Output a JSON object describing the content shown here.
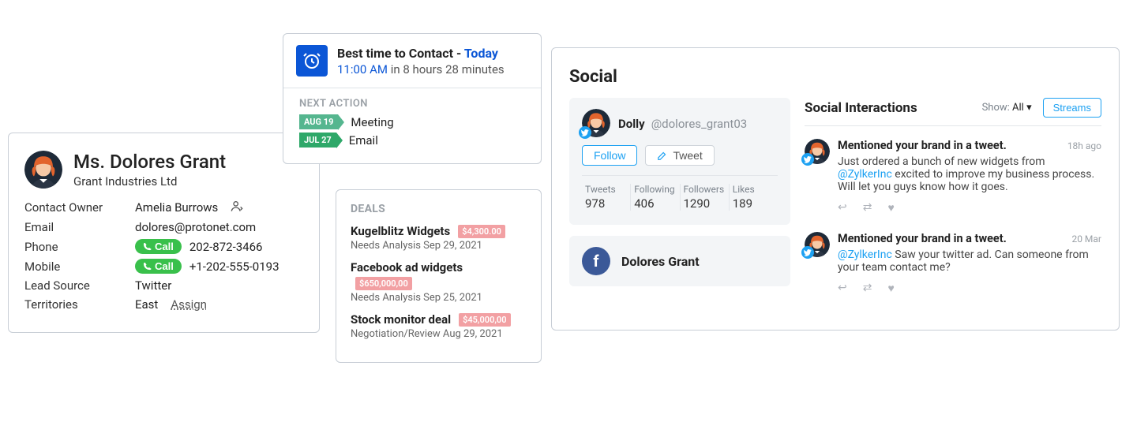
{
  "contact": {
    "name": "Ms. Dolores Grant",
    "company": "Grant Industries Ltd",
    "fields": {
      "owner_label": "Contact Owner",
      "owner_value": "Amelia Burrows",
      "email_label": "Email",
      "email_value": "dolores@protonet.com",
      "phone_label": "Phone",
      "phone_value": "202-872-3466",
      "mobile_label": "Mobile",
      "mobile_value": "+1-202-555-0193",
      "lead_label": "Lead Source",
      "lead_value": "Twitter",
      "territory_label": "Territories",
      "territory_value": "East",
      "assign_label": "Assign",
      "call_label": "Call"
    }
  },
  "best_time": {
    "title_prefix": "Best time to Contact - ",
    "day": "Today",
    "time": "11:00 AM",
    "countdown": " in 8 hours 28 minutes",
    "next_action_label": "NEXT ACTION",
    "actions": [
      {
        "date": "AUG 19",
        "label": "Meeting"
      },
      {
        "date": "JUL 27",
        "label": "Email"
      }
    ]
  },
  "deals": {
    "heading": "DEALS",
    "items": [
      {
        "name": "Kugelblitz Widgets",
        "amount": "$4,300.00",
        "sub": "Needs Analysis Sep 29, 2021"
      },
      {
        "name": "Facebook ad widgets",
        "amount": "$650,000,00",
        "sub": "Needs Analysis Sep 25, 2021"
      },
      {
        "name": "Stock monitor deal",
        "amount": "$45,000,00",
        "sub": "Negotiation/Review Aug 29, 2021"
      }
    ]
  },
  "social": {
    "title": "Social",
    "profile": {
      "display_name": "Dolly",
      "handle": "@dolores_grant03",
      "follow_label": "Follow",
      "tweet_label": "Tweet",
      "stats": {
        "tweets_label": "Tweets",
        "tweets": "978",
        "following_label": "Following",
        "following": "406",
        "followers_label": "Followers",
        "followers": "1290",
        "likes_label": "Likes",
        "likes": "189"
      }
    },
    "facebook_name": "Dolores Grant",
    "interactions": {
      "heading": "Social Interactions",
      "show_label": "Show:",
      "show_value": "All",
      "streams_label": "Streams",
      "items": [
        {
          "title": "Mentioned your brand in a tweet.",
          "time": "18h ago",
          "text_pre": "Just ordered a bunch of new widgets from ",
          "mention": "@ZylkerInc",
          "text_post": " excited to improve my business process. Will let you guys know how it goes."
        },
        {
          "title": "Mentioned your brand in a tweet.",
          "time": "20 Mar",
          "text_pre": "",
          "mention": "@ZylkerInc",
          "text_post": " Saw your twitter ad. Can someone from your team contact me?"
        }
      ]
    }
  }
}
